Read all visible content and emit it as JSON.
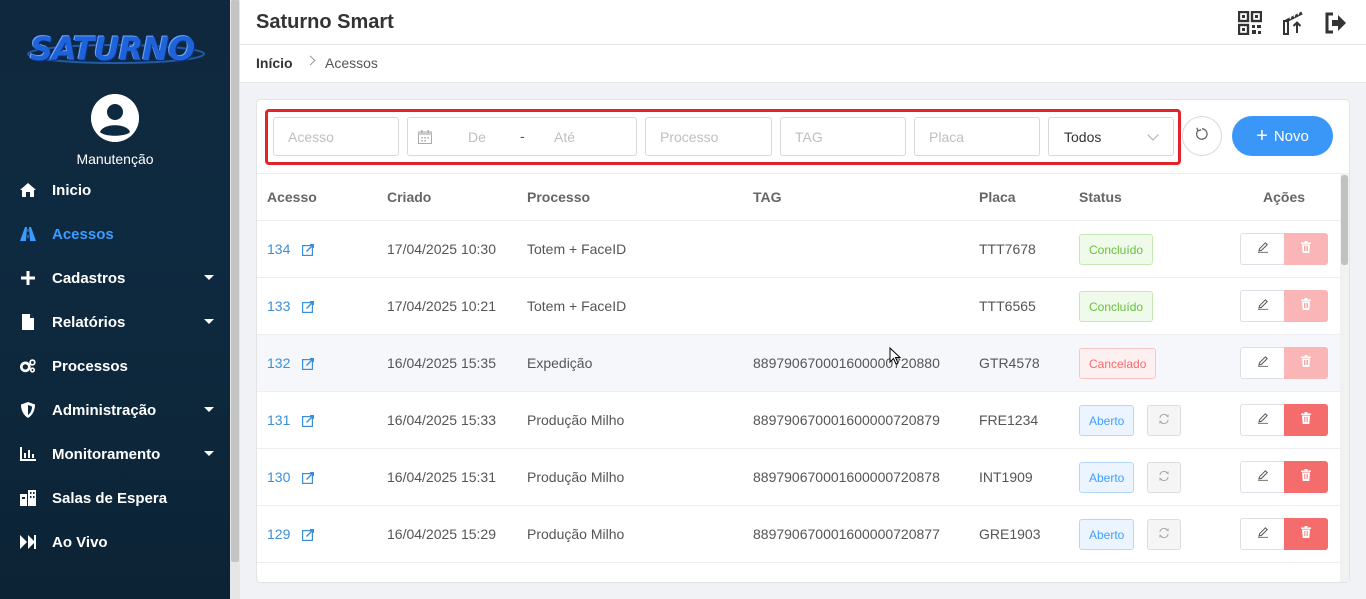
{
  "sidebar": {
    "logo_text": "SATURNO",
    "user_name": "Manutenção",
    "items": [
      {
        "label": "Inicio",
        "icon": "home-icon",
        "active": false,
        "has_submenu": false
      },
      {
        "label": "Acessos",
        "icon": "road-icon",
        "active": true,
        "has_submenu": false
      },
      {
        "label": "Cadastros",
        "icon": "plus-icon",
        "active": false,
        "has_submenu": true
      },
      {
        "label": "Relatórios",
        "icon": "file-icon",
        "active": false,
        "has_submenu": true
      },
      {
        "label": "Processos",
        "icon": "cogs-icon",
        "active": false,
        "has_submenu": false
      },
      {
        "label": "Administração",
        "icon": "shield-icon",
        "active": false,
        "has_submenu": true
      },
      {
        "label": "Monitoramento",
        "icon": "chart-icon",
        "active": false,
        "has_submenu": true
      },
      {
        "label": "Salas de Espera",
        "icon": "building-icon",
        "active": false,
        "has_submenu": false
      },
      {
        "label": "Ao Vivo",
        "icon": "forward-icon",
        "active": false,
        "has_submenu": false
      }
    ],
    "accent_color": "#3b9cff"
  },
  "header": {
    "title": "Saturno Smart",
    "icons": [
      "qrcode-icon",
      "barrier-icon",
      "logout-icon"
    ]
  },
  "breadcrumb": {
    "home": "Início",
    "current": "Acessos"
  },
  "filters": {
    "acesso_placeholder": "Acesso",
    "date_from_placeholder": "De",
    "date_separator": "-",
    "date_to_placeholder": "Até",
    "processo_placeholder": "Processo",
    "tag_placeholder": "TAG",
    "placa_placeholder": "Placa",
    "status_selected": "Todos",
    "new_button_label": "Novo"
  },
  "table": {
    "columns": [
      "Acesso",
      "Criado",
      "Processo",
      "TAG",
      "Placa",
      "Status",
      "Ações"
    ],
    "rows": [
      {
        "acesso": "134",
        "criado": "17/04/2025 10:30",
        "processo": "Totem + FaceID",
        "tag": "",
        "placa": "TTT7678",
        "status": "Concluído",
        "status_type": "done"
      },
      {
        "acesso": "133",
        "criado": "17/04/2025 10:21",
        "processo": "Totem + FaceID",
        "tag": "",
        "placa": "TTT6565",
        "status": "Concluído",
        "status_type": "done"
      },
      {
        "acesso": "132",
        "criado": "16/04/2025 15:35",
        "processo": "Expedição",
        "tag": "889790670001600000720880",
        "placa": "GTR4578",
        "status": "Cancelado",
        "status_type": "cancel"
      },
      {
        "acesso": "131",
        "criado": "16/04/2025 15:33",
        "processo": "Produção Milho",
        "tag": "889790670001600000720879",
        "placa": "FRE1234",
        "status": "Aberto",
        "status_type": "open"
      },
      {
        "acesso": "130",
        "criado": "16/04/2025 15:31",
        "processo": "Produção Milho",
        "tag": "889790670001600000720878",
        "placa": "INT1909",
        "status": "Aberto",
        "status_type": "open"
      },
      {
        "acesso": "129",
        "criado": "16/04/2025 15:29",
        "processo": "Produção Milho",
        "tag": "889790670001600000720877",
        "placa": "GRE1903",
        "status": "Aberto",
        "status_type": "open"
      }
    ],
    "status_colors": {
      "done": "#67c23a",
      "cancel": "#f56c6c",
      "open": "#409eff"
    }
  }
}
